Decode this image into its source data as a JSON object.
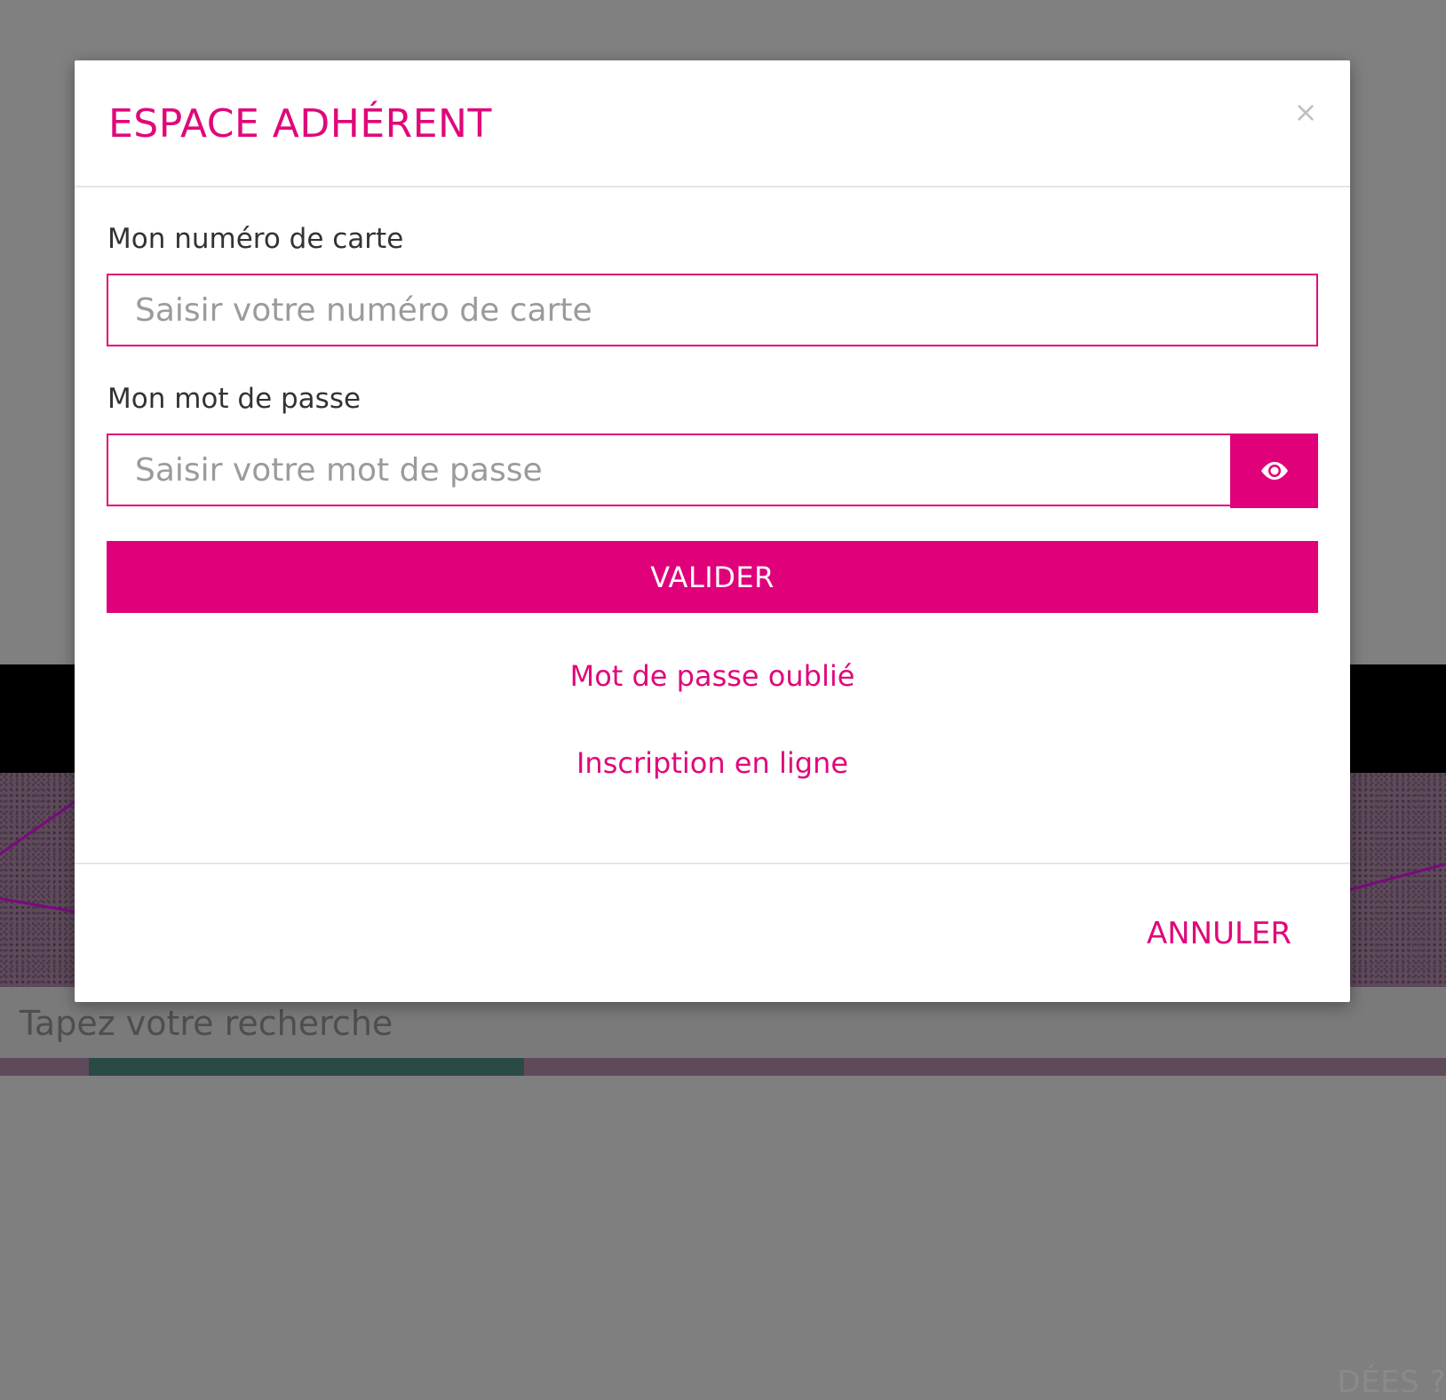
{
  "background": {
    "band_text": "DÉES ?",
    "search_placeholder": "Tapez votre recherche"
  },
  "modal": {
    "title": "ESPACE ADHÉRENT",
    "close_label": "×",
    "card_label": "Mon numéro de carte",
    "card_placeholder": "Saisir votre numéro de carte",
    "card_value": "",
    "password_label": "Mon mot de passe",
    "password_placeholder": "Saisir votre mot de passe",
    "password_value": "",
    "show_password_icon": "eye-icon",
    "submit_label": "VALIDER",
    "forgot_password_link": "Mot de passe oublié",
    "register_link": "Inscription en ligne",
    "cancel_label": "ANNULER"
  },
  "colors": {
    "accent": "#e0007a",
    "overlay": "#808080"
  }
}
